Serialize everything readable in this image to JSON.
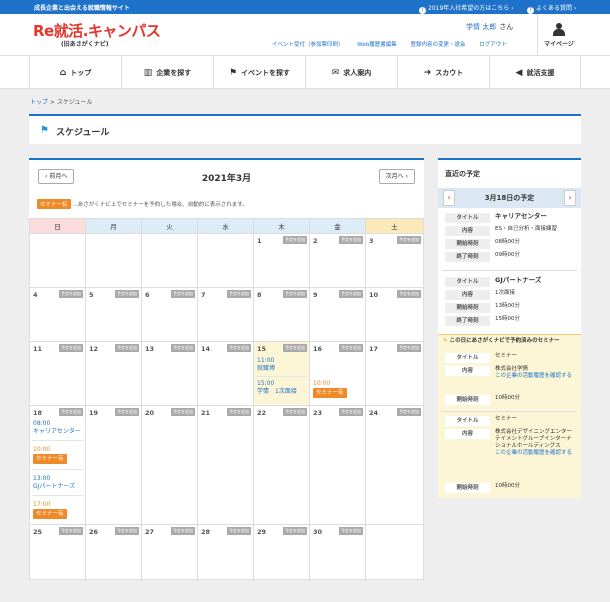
{
  "topbar": {
    "tagline": "成長企業と出会える就職情報サイト",
    "link1": "2019年入社希望の方はこちら",
    "link2": "よくある質問"
  },
  "header": {
    "logo": "Re就活.キャンパス",
    "logo_sub": "(旧あさがくナビ)",
    "user_name": "学情 太郎",
    "user_suffix": "さん",
    "links": [
      "イベント受付（参加票印刷）",
      "Web履歴書編集",
      "登録内容の変更・退会",
      "ログアウト"
    ],
    "mypage_label": "マイページ"
  },
  "nav": [
    {
      "label": "トップ",
      "icon": "home-icon"
    },
    {
      "label": "企業を探す",
      "icon": "building-icon"
    },
    {
      "label": "イベントを探す",
      "icon": "flag-icon"
    },
    {
      "label": "求人案内",
      "icon": "mail-icon"
    },
    {
      "label": "スカウト",
      "icon": "shoe-icon"
    },
    {
      "label": "就活支援",
      "icon": "megaphone-icon"
    }
  ],
  "breadcrumb": {
    "top": "トップ",
    "sep": ">",
    "current": "スケジュール"
  },
  "page_title": "スケジュール",
  "calendar": {
    "prev_label": "前月へ",
    "next_label": "次月へ",
    "month_label": "2021年3月",
    "legend_tag": "セミナー有",
    "legend_text": "…あさがくナビ上でセミナーを予約した場合、自動的に表示されます。",
    "weekdays": [
      "日",
      "月",
      "火",
      "水",
      "木",
      "金",
      "土"
    ],
    "add_label": "予定を追加",
    "seminar_tag": "セミナー有",
    "weeks": [
      [
        "",
        "",
        "",
        "",
        "1",
        "2",
        "3"
      ],
      [
        "4",
        "5",
        "6",
        "7",
        "8",
        "9",
        "10"
      ],
      [
        "11",
        "12",
        "13",
        "14",
        "15",
        "16",
        "17"
      ],
      [
        "18",
        "19",
        "20",
        "21",
        "22",
        "23",
        "24"
      ],
      [
        "25",
        "26",
        "27",
        "28",
        "29",
        "30",
        ""
      ]
    ],
    "events": {
      "d15_1_time": "11:00",
      "d15_1_title": "就職博",
      "d15_2_time": "15:00",
      "d15_2_title": "学情　1次面接",
      "d16_time": "10:00",
      "d18_1_time": "08:00",
      "d18_1_title": "キャリアセンター",
      "d18_2_time": "10:00",
      "d18_3_time": "13:00",
      "d18_3_title": "GJパートナーズ",
      "d18_4_time": "17:00"
    }
  },
  "sidebar": {
    "heading": "直近の予定",
    "date_label": "3月18日の予定",
    "labels": {
      "title": "タイトル",
      "content": "内容",
      "start": "開始時刻",
      "end": "終了時刻"
    },
    "items": [
      {
        "title": "キャリアセンター",
        "content": "ES・自己分析・面接練習",
        "start": "08時00分",
        "end": "09時00分"
      },
      {
        "title": "GJパートナーズ",
        "content": "1次面接",
        "start": "13時00分",
        "end": "15時00分"
      }
    ],
    "seminar_heading": "この日にあさがくナビで予約済みのセミナー",
    "seminars": [
      {
        "title": "セミナー",
        "content": "株式会社学情",
        "link": "この企業の活動履歴を確認する",
        "start": "10時00分"
      },
      {
        "title": "セミナー",
        "content": "株式会社デザイニングエンターテイメントグループインターナショナルホールディングス",
        "link": "この企業の活動履歴を確認する",
        "start": "10時00分"
      }
    ]
  }
}
